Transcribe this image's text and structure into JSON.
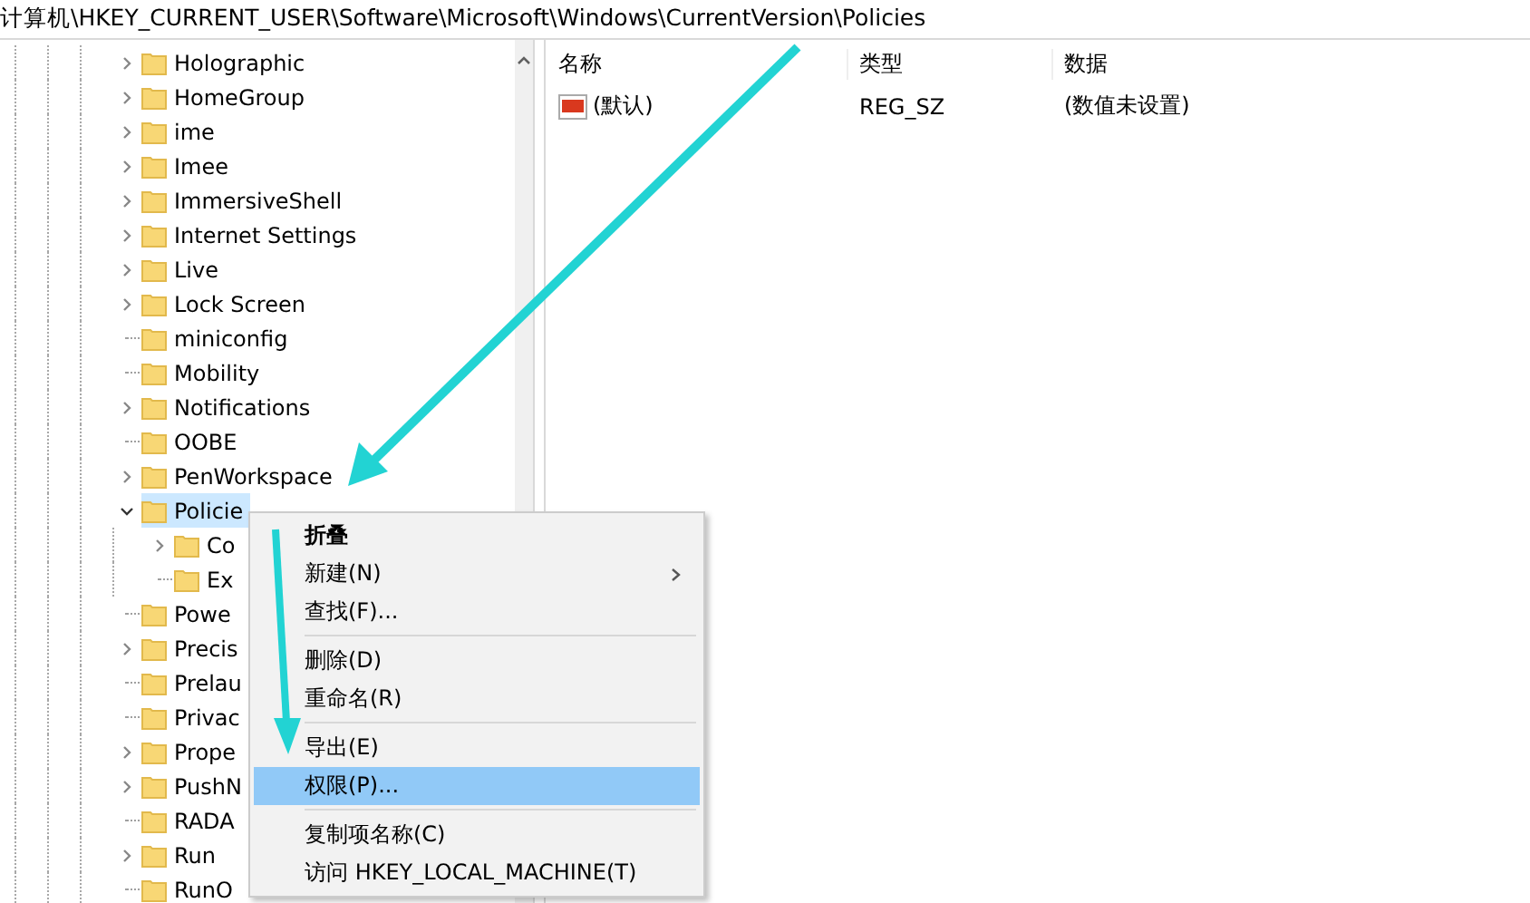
{
  "address_bar": {
    "path": "计算机\\HKEY_CURRENT_USER\\Software\\Microsoft\\Windows\\CurrentVersion\\Policies"
  },
  "tree": {
    "items": [
      {
        "label": "Holographic",
        "expanded": false,
        "selected": false
      },
      {
        "label": "HomeGroup",
        "expanded": false,
        "selected": false
      },
      {
        "label": "ime",
        "expanded": false,
        "selected": false
      },
      {
        "label": "Imee",
        "expanded": false,
        "selected": false
      },
      {
        "label": "ImmersiveShell",
        "expanded": false,
        "selected": false
      },
      {
        "label": "Internet Settings",
        "expanded": false,
        "selected": false
      },
      {
        "label": "Live",
        "expanded": false,
        "selected": false
      },
      {
        "label": "Lock Screen",
        "expanded": false,
        "selected": false
      },
      {
        "label": "miniconfig",
        "selected": false
      },
      {
        "label": "Mobility",
        "selected": false
      },
      {
        "label": "Notifications",
        "expanded": false,
        "selected": false
      },
      {
        "label": "OOBE",
        "selected": false
      },
      {
        "label": "PenWorkspace",
        "expanded": false,
        "selected": false
      },
      {
        "label": "Policie",
        "expanded": true,
        "selected": true,
        "children": [
          {
            "label": "Co",
            "expanded": false,
            "selected": false
          },
          {
            "label": "Ex",
            "selected": false
          }
        ]
      },
      {
        "label": "Powe",
        "selected": false
      },
      {
        "label": "Precis",
        "expanded": false,
        "selected": false
      },
      {
        "label": "Prelau",
        "selected": false
      },
      {
        "label": "Privac",
        "selected": false
      },
      {
        "label": "Prope",
        "expanded": false,
        "selected": false
      },
      {
        "label": "PushN",
        "expanded": false,
        "selected": false
      },
      {
        "label": "RADA",
        "selected": false
      },
      {
        "label": "Run",
        "expanded": false,
        "selected": false
      },
      {
        "label": "RunO",
        "selected": false
      }
    ]
  },
  "values": {
    "columns": [
      "名称",
      "类型",
      "数据"
    ],
    "rows": [
      {
        "name": "(默认)",
        "type": "REG_SZ",
        "data": "(数值未设置)"
      }
    ]
  },
  "context_menu": {
    "items": [
      {
        "kind": "item",
        "label": "折叠",
        "default": true,
        "submenu": false,
        "selected": false
      },
      {
        "kind": "item",
        "label": "新建(N)",
        "default": false,
        "submenu": true,
        "selected": false
      },
      {
        "kind": "item",
        "label": "查找(F)...",
        "default": false,
        "submenu": false,
        "selected": false
      },
      {
        "kind": "separator"
      },
      {
        "kind": "item",
        "label": "删除(D)",
        "default": false,
        "submenu": false,
        "selected": false
      },
      {
        "kind": "item",
        "label": "重命名(R)",
        "default": false,
        "submenu": false,
        "selected": false
      },
      {
        "kind": "separator"
      },
      {
        "kind": "item",
        "label": "导出(E)",
        "default": false,
        "submenu": false,
        "selected": false
      },
      {
        "kind": "item",
        "label": "权限(P)...",
        "default": false,
        "submenu": false,
        "selected": true
      },
      {
        "kind": "separator"
      },
      {
        "kind": "item",
        "label": "复制项名称(C)",
        "default": false,
        "submenu": false,
        "selected": false
      },
      {
        "kind": "item",
        "label": "访问 HKEY_LOCAL_MACHINE(T)",
        "default": false,
        "submenu": false,
        "selected": false
      }
    ]
  }
}
